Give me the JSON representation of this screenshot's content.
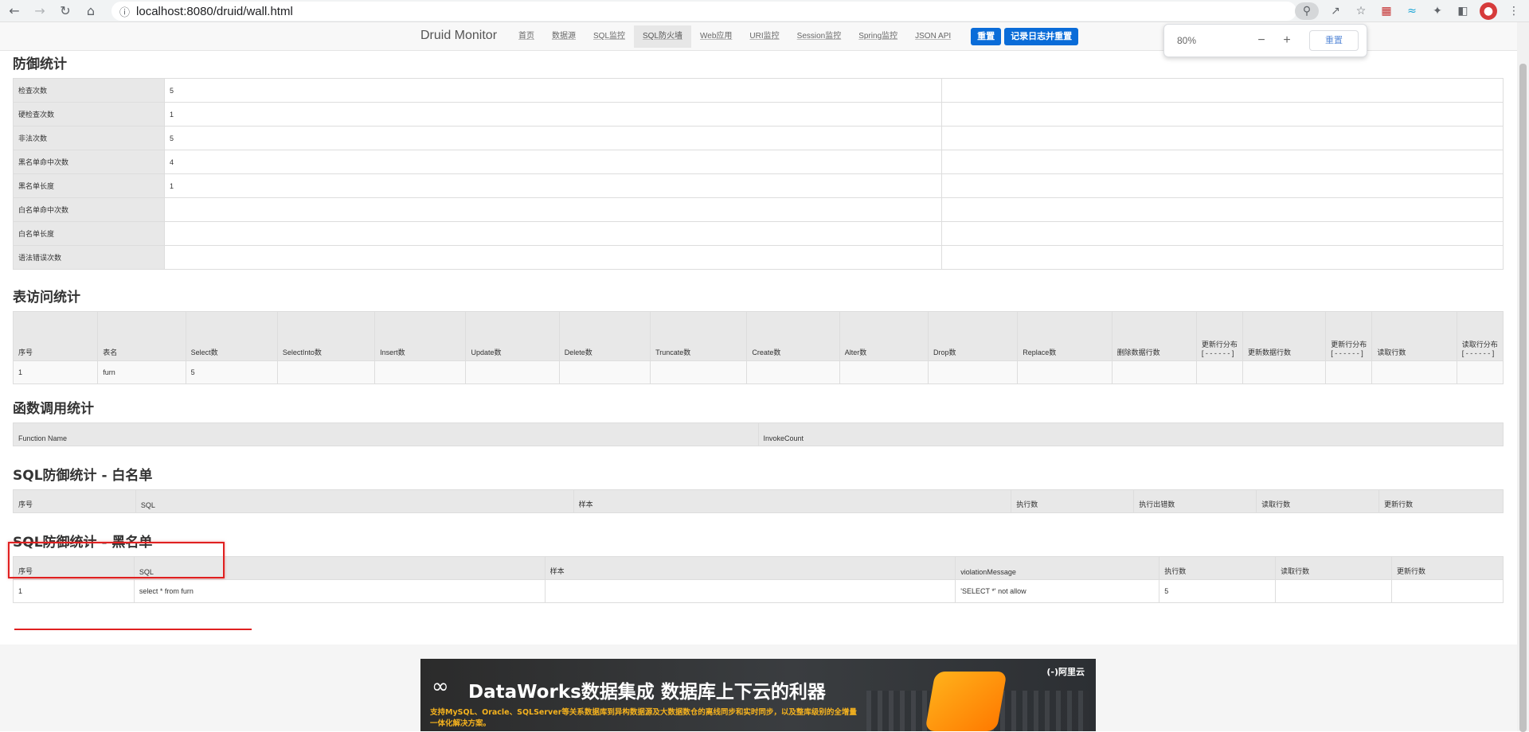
{
  "browser": {
    "url": "localhost:8080/druid/wall.html"
  },
  "nav": {
    "brand": "Druid Monitor",
    "items": [
      "首页",
      "数据源",
      "SQL监控",
      "SQL防火墙",
      "Web应用",
      "URI监控",
      "Session监控",
      "Spring监控",
      "JSON API"
    ],
    "active_index": 3,
    "reset_label": "重置",
    "log_reset_label": "记录日志并重置"
  },
  "zoom": {
    "level": "80%",
    "minus": "−",
    "plus": "+",
    "reset_label": "重置"
  },
  "defense": {
    "title": "防御统计",
    "rows": [
      {
        "label": "检查次数",
        "value": "5"
      },
      {
        "label": "硬检查次数",
        "value": "1"
      },
      {
        "label": "非法次数",
        "value": "5"
      },
      {
        "label": "黑名单命中次数",
        "value": "4"
      },
      {
        "label": "黑名单长度",
        "value": "1"
      },
      {
        "label": "白名单命中次数",
        "value": ""
      },
      {
        "label": "白名单长度",
        "value": ""
      },
      {
        "label": "语法错误次数",
        "value": ""
      }
    ]
  },
  "table_access": {
    "title": "表访问统计",
    "headers": [
      "序号",
      "表名",
      "Select数",
      "SelectInto数",
      "Insert数",
      "Update数",
      "Delete数",
      "Truncate数",
      "Create数",
      "Alter数",
      "Drop数",
      "Replace数",
      "删除数据行数",
      "更新行分布 [ - - - - - - ]",
      "更新数据行数",
      "更新行分布 [ - - - - - - ]",
      "读取行数",
      "读取行分布 [ - - - - - - ]"
    ],
    "rows": [
      [
        "1",
        "furn",
        "5",
        "",
        "",
        "",
        "",
        "",
        "",
        "",
        "",
        "",
        "",
        "",
        "",
        "",
        "",
        ""
      ]
    ]
  },
  "functions": {
    "title": "函数调用统计",
    "headers": [
      "Function Name",
      "InvokeCount"
    ]
  },
  "whitelist": {
    "title": "SQL防御统计 - 白名单",
    "headers": [
      "序号",
      "SQL",
      "样本",
      "执行数",
      "执行出错数",
      "读取行数",
      "更新行数"
    ]
  },
  "blacklist": {
    "title": "SQL防御统计 - 黑名单",
    "headers": [
      "序号",
      "SQL",
      "样本",
      "violationMessage",
      "执行数",
      "读取行数",
      "更新行数"
    ],
    "rows": [
      [
        "1",
        "select * from furn",
        "",
        "'SELECT *' not allow",
        "5",
        "",
        ""
      ]
    ]
  },
  "banner": {
    "title": "DataWorks数据集成 数据库上下云的利器",
    "subtitle": "支持MySQL、Oracle、SQLServer等关系数据库到异构数据源及大数据数仓的离线同步和实时同步，以及整库级别的全增量一体化解决方案。",
    "brand": "(-)阿里云"
  },
  "colors": {
    "primary_button": "#0a6cd8",
    "highlight": "#e02020",
    "header_bg": "#e8e8e8"
  }
}
